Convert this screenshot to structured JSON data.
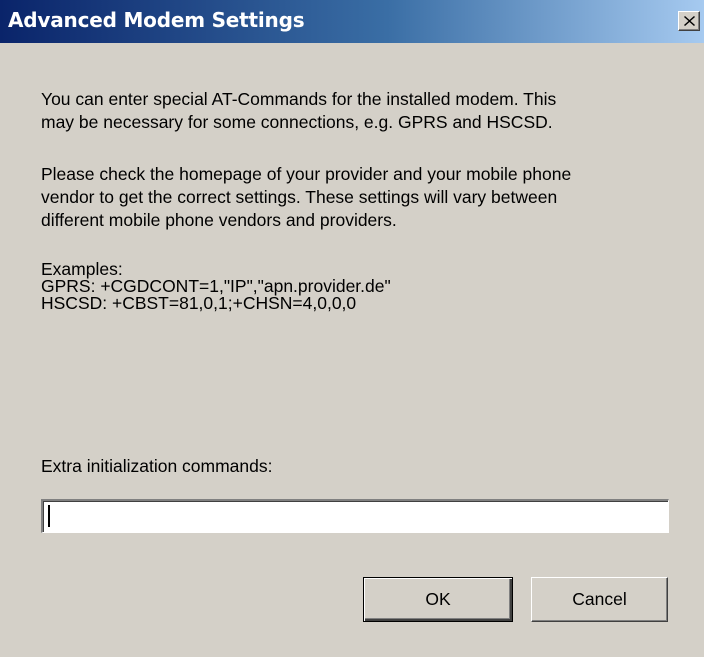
{
  "window": {
    "title": "Advanced Modem Settings"
  },
  "content": {
    "intro_line1": "You can enter special AT-Commands for the installed modem. This",
    "intro_line2": "may be necessary for some connections, e.g. GPRS and HSCSD.",
    "advice_line1": "Please check the homepage of your provider and your mobile phone",
    "advice_line2": "vendor to get the correct settings. These settings will vary between",
    "advice_line3": "different mobile phone vendors and providers.",
    "examples_heading": "Examples:",
    "example_gprs": "GPRS: +CGDCONT=1,\"IP\",\"apn.provider.de\"",
    "example_hscsd": "HSCSD: +CBST=81,0,1;+CHSN=4,0,0,0"
  },
  "form": {
    "init_label": "Extra initialization commands:",
    "init_value": ""
  },
  "buttons": {
    "ok_label": "OK",
    "cancel_label": "Cancel"
  },
  "icons": {
    "close": "close-icon"
  }
}
